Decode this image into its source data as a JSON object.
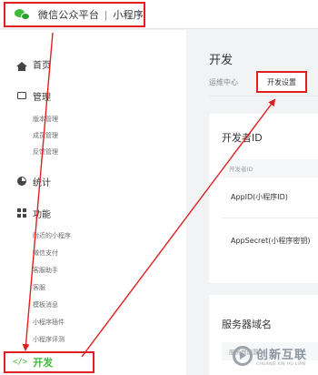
{
  "topbar": {
    "logo_icon": "wechat-logo-icon",
    "platform": "微信公众平台",
    "separator": "|",
    "product": "小程序"
  },
  "sidebar": {
    "home": {
      "label": "首页",
      "icon": "home-icon"
    },
    "manage": {
      "label": "管理",
      "icon": "manage-icon",
      "items": [
        "版本管理",
        "成员管理",
        "反馈管理"
      ]
    },
    "stats": {
      "label": "统计",
      "icon": "stats-icon"
    },
    "features": {
      "label": "功能",
      "icon": "grid-icon",
      "items": [
        "附近的小程序",
        "微信支付",
        "客服助手",
        "客服",
        "模板消息",
        "小程序插件",
        "小程序评测"
      ]
    },
    "develop": {
      "label": "开发",
      "icon_text": "</>"
    }
  },
  "main": {
    "title": "开发",
    "tabs": [
      {
        "label": "运维中心"
      },
      {
        "label": "开发设置",
        "active": true
      }
    ],
    "developer_card": {
      "title": "开发者ID",
      "header": "开发者ID",
      "rows": [
        "AppID(小程序ID)",
        "AppSecret(小程序密钥)"
      ]
    },
    "server_card": {
      "title": "服务器域名",
      "header": "服务器配置"
    }
  },
  "watermark": {
    "main": "创新互联",
    "sub": "CHUANG XIN HU LIAN"
  },
  "colors": {
    "annotation": "#e02020",
    "accent": "#3fbb3b",
    "background": "#f2f3f5"
  }
}
